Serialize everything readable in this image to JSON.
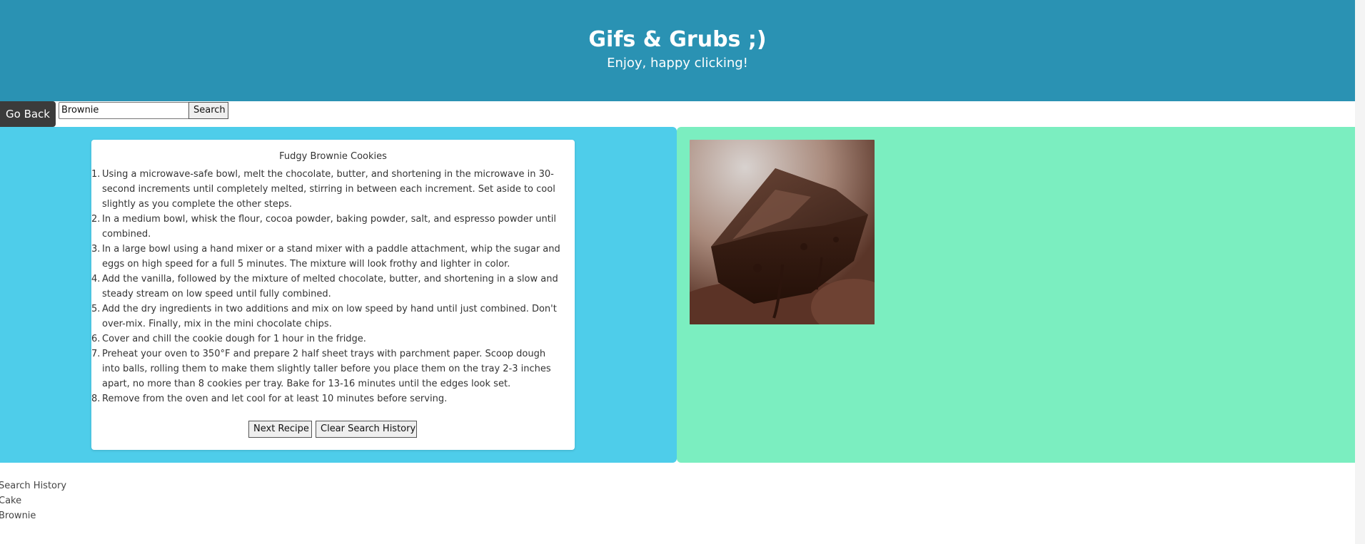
{
  "header": {
    "title": "Gifs & Grubs ;)",
    "subtitle": "Enjoy, happy clicking!"
  },
  "nav": {
    "go_back_label": "Go Back"
  },
  "search": {
    "value": "Brownie",
    "button_label": "Search"
  },
  "recipe": {
    "title": "Fudgy Brownie Cookies",
    "steps": [
      "Using a microwave-safe bowl, melt the chocolate, butter, and shortening in the microwave in 30-second increments until completely melted, stirring in between each increment. Set aside to cool slightly as you complete the other steps.",
      "In a medium bowl, whisk the flour, cocoa powder, baking powder, salt, and espresso powder until combined.",
      "In a large bowl using a hand mixer or a stand mixer with a paddle attachment, whip the sugar and eggs on high speed for a full 5 minutes. The mixture will look frothy and lighter in color.",
      "Add the vanilla, followed by the mixture of melted chocolate, butter, and shortening in a slow and steady stream on low speed until fully combined.",
      "Add the dry ingredients in two additions and mix on low speed by hand until just combined. Don't over-mix. Finally, mix in the mini chocolate chips.",
      "Cover and chill the cookie dough for 1 hour in the fridge.",
      "Preheat your oven to 350°F and prepare 2 half sheet trays with parchment paper. Scoop dough into balls, rolling them to make them slightly taller before you place them on the tray 2-3 inches apart, no more than 8 cookies per tray. Bake for 13-16 minutes until the edges look set.",
      "Remove from the oven and let cool for at least 10 minutes before serving."
    ],
    "step_numbers": [
      "1.",
      "2.",
      "3.",
      "4.",
      "5.",
      "6.",
      "7.",
      "8."
    ],
    "next_label": "Next Recipe",
    "clear_label": "Clear Search History"
  },
  "history": {
    "heading": "Search History",
    "items": [
      "Cake",
      "Brownie"
    ]
  },
  "colors": {
    "header_bg": "#2a92b3",
    "left_panel_bg": "#4ecdea",
    "right_panel_bg": "#7beec0",
    "go_back_bg": "#3b3b3b"
  },
  "image": {
    "icon": "brownie-gif-image"
  }
}
